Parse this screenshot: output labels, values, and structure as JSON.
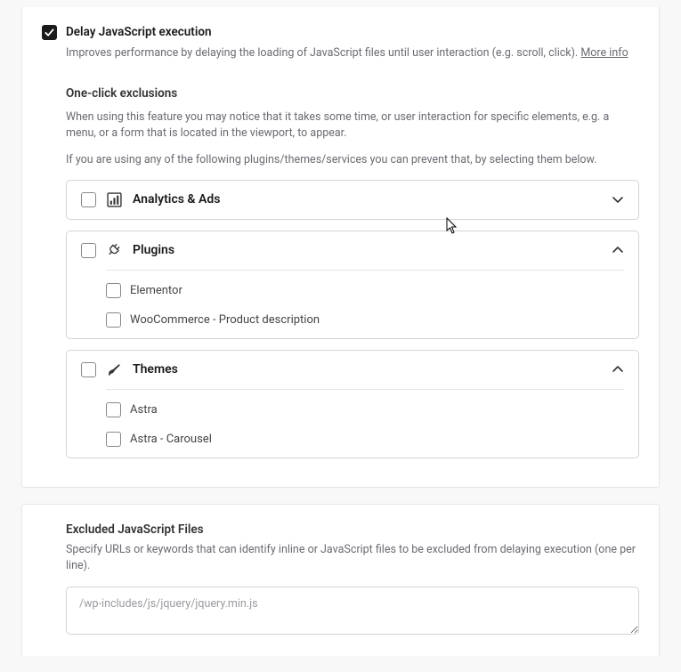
{
  "delayJs": {
    "checked": true,
    "title": "Delay JavaScript execution",
    "description": "Improves performance by delaying the loading of JavaScript files until user interaction (e.g. scroll, click).",
    "moreInfo": "More info"
  },
  "exclusions": {
    "heading": "One-click exclusions",
    "text1": "When using this feature you may notice that it takes some time, or user interaction for specific elements, e.g. a menu, or a form that is located in the viewport, to appear.",
    "text2": "If you are using any of the following plugins/themes/services you can prevent that, by selecting them below."
  },
  "accordions": {
    "analytics": {
      "label": "Analytics & Ads",
      "expanded": false
    },
    "plugins": {
      "label": "Plugins",
      "expanded": true,
      "items": [
        {
          "label": "Elementor"
        },
        {
          "label": "WooCommerce - Product description"
        }
      ]
    },
    "themes": {
      "label": "Themes",
      "expanded": true,
      "items": [
        {
          "label": "Astra"
        },
        {
          "label": "Astra - Carousel"
        }
      ]
    }
  },
  "excluded": {
    "heading": "Excluded JavaScript Files",
    "description": "Specify URLs or keywords that can identify inline or JavaScript files to be excluded from delaying execution (one per line).",
    "placeholder": "/wp-includes/js/jquery/jquery.min.js",
    "value": ""
  }
}
